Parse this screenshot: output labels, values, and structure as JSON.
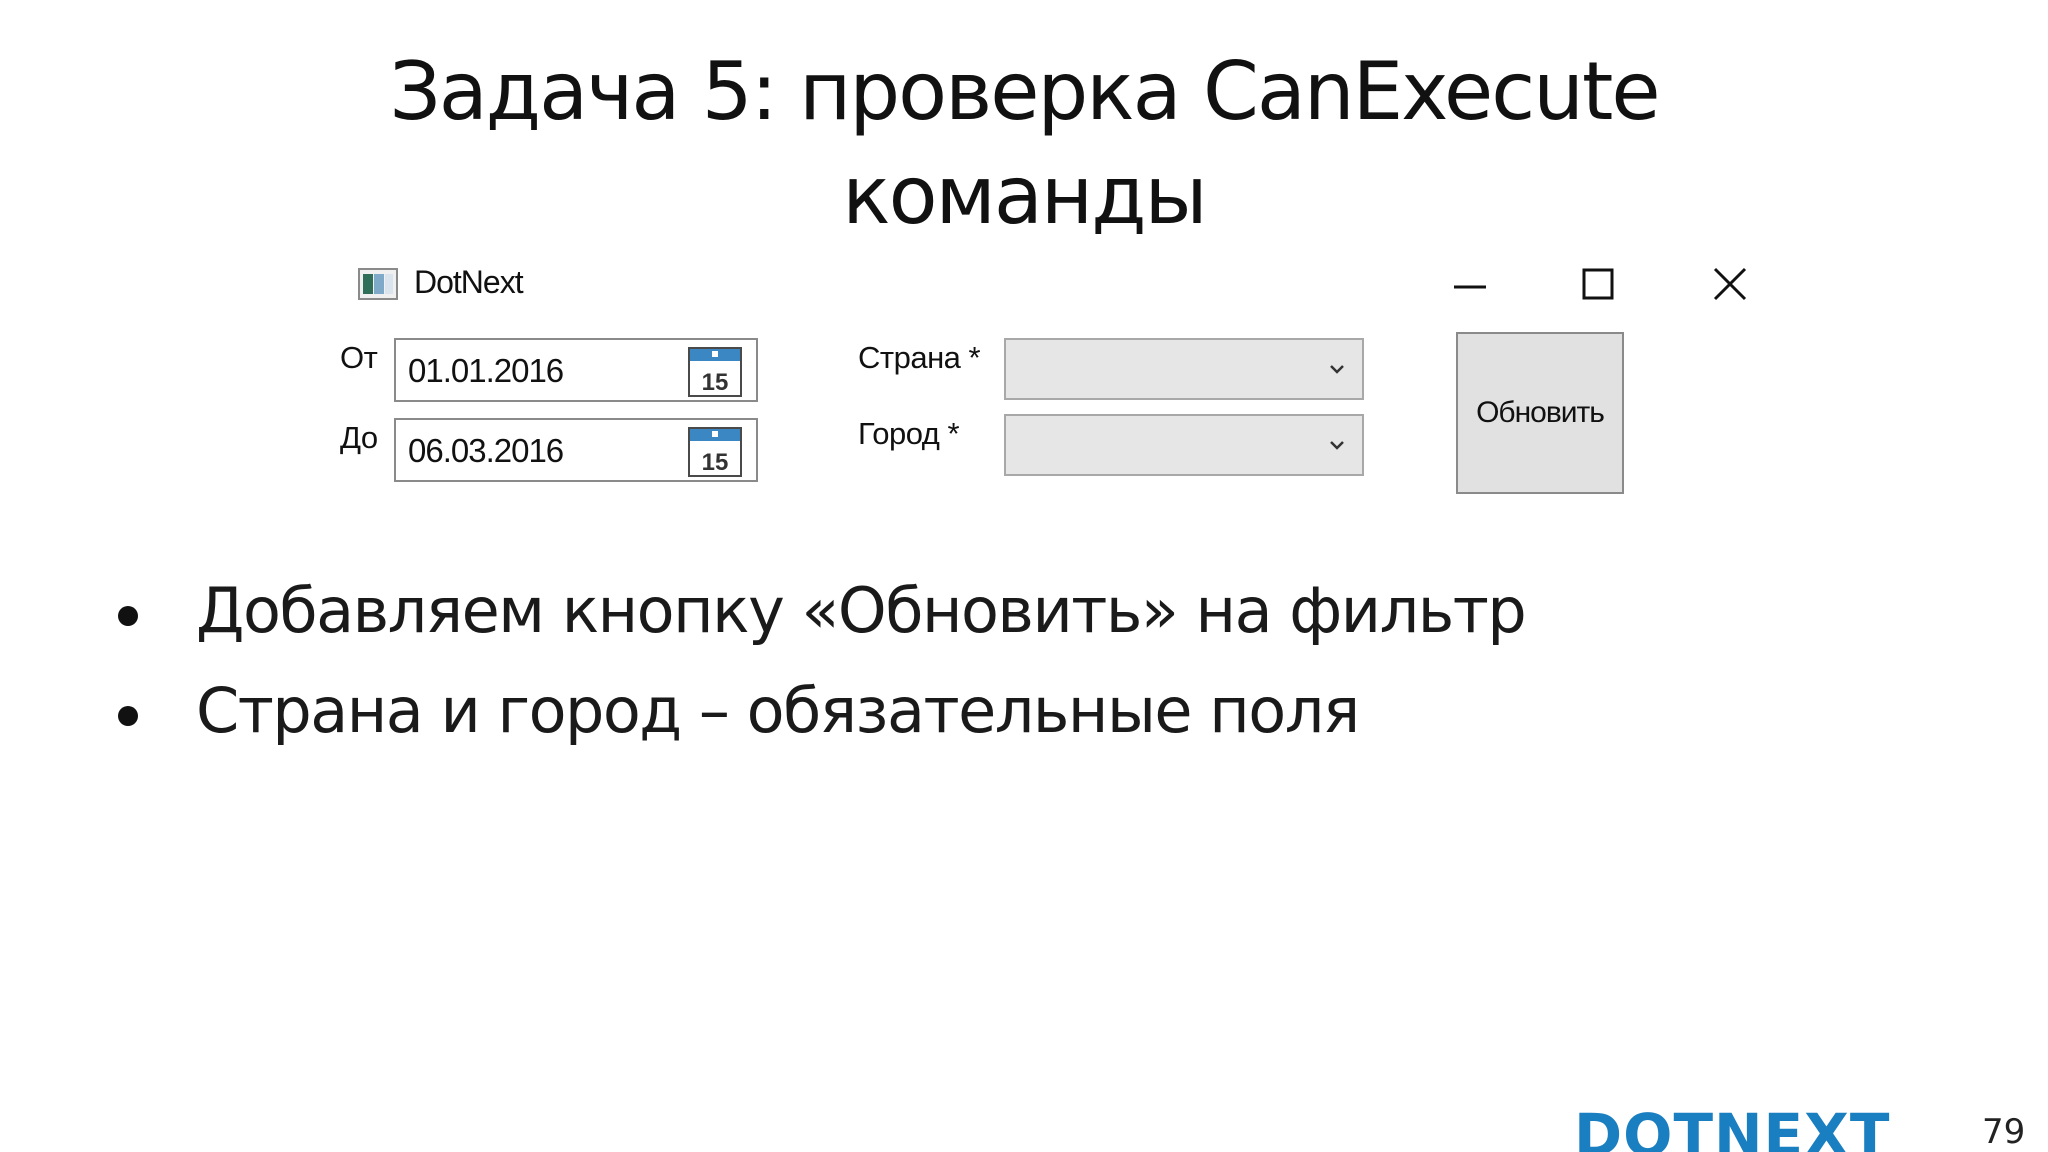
{
  "slide": {
    "title_line1": "Задача 5: проверка CanExecute",
    "title_line2": "команды",
    "page_number": "79",
    "logo_text": "DOTNEXT",
    "brand_color": "#1a7fc1"
  },
  "window": {
    "title": "DotNext",
    "icons": {
      "app": "window-app-icon",
      "minimize": "minimize-icon",
      "maximize": "maximize-icon",
      "close": "close-icon",
      "calendar": "calendar-icon",
      "dropdown": "chevron-down-icon"
    },
    "from_label": "От",
    "from_value": "01.01.2016",
    "to_label": "До",
    "to_value": "06.03.2016",
    "calendar_day": "15",
    "country_label": "Страна *",
    "country_value": "",
    "city_label": "Город *",
    "city_value": "",
    "refresh_label": "Обновить"
  },
  "bullets": [
    "Добавляем кнопку «Обновить» на фильтр",
    "Страна и город – обязательные поля"
  ]
}
